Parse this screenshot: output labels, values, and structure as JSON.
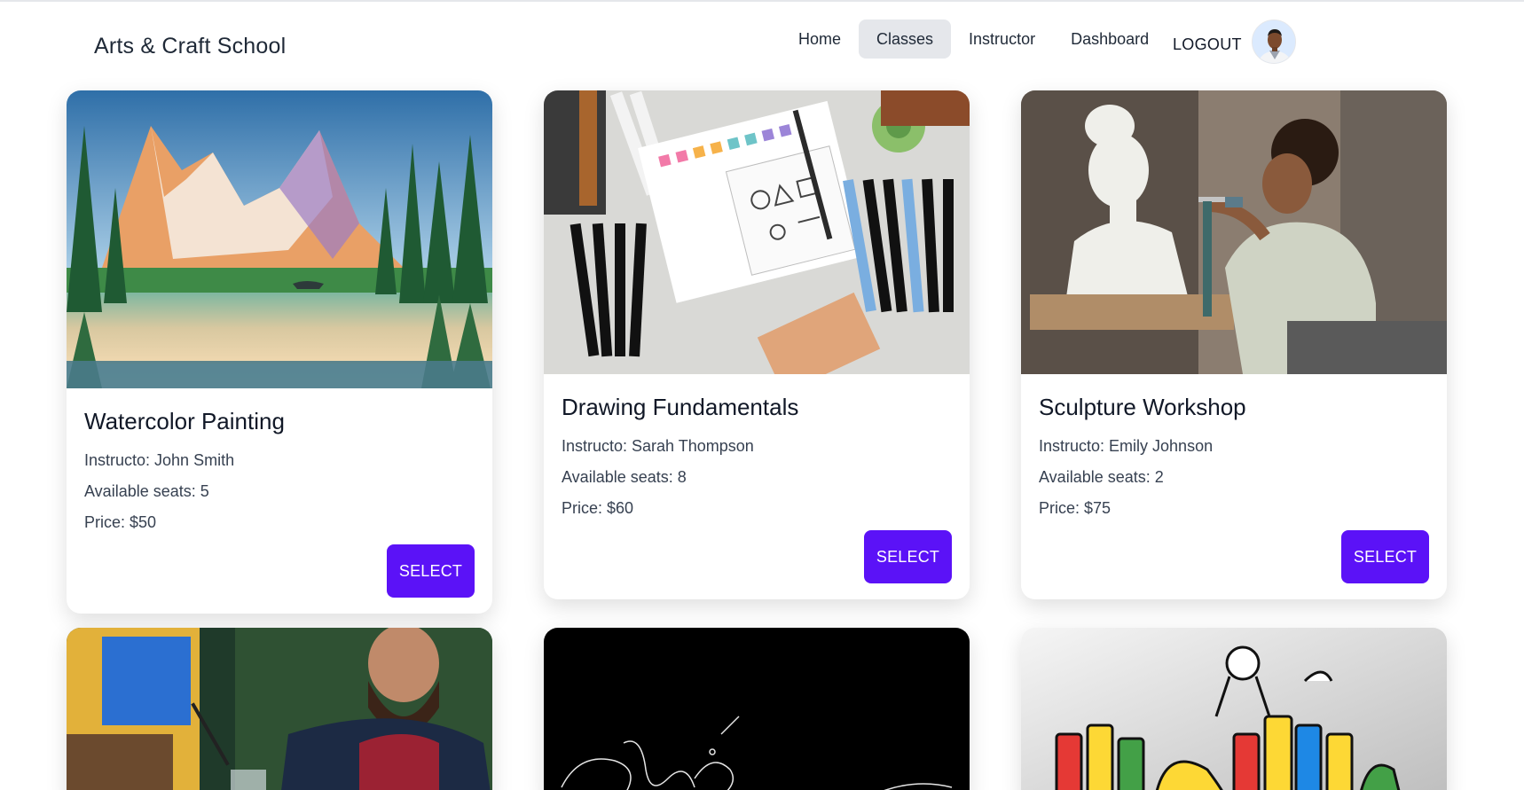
{
  "header": {
    "brand": "Arts & Craft School",
    "nav": [
      {
        "label": "Home"
      },
      {
        "label": "Classes",
        "active": true
      },
      {
        "label": "Instructor"
      },
      {
        "label": "Dashboard"
      }
    ],
    "logout_label": "LOGOUT",
    "avatar_icon": "user-avatar"
  },
  "colors": {
    "accent": "#5b12f7",
    "active_nav_bg": "#e5e7eb"
  },
  "classes": [
    {
      "title": "Watercolor Painting",
      "instructor": "Instructo: John Smith",
      "seats": "Available seats: 5",
      "price": "Price: $50",
      "button": "SELECT",
      "image": "watercolor-mountain-lake"
    },
    {
      "title": "Drawing Fundamentals",
      "instructor": "Instructo: Sarah Thompson",
      "seats": "Available seats: 8",
      "price": "Price: $60",
      "button": "SELECT",
      "image": "drawing-markers-sketchbook"
    },
    {
      "title": "Sculpture Workshop",
      "instructor": "Instructo: Emily Johnson",
      "seats": "Available seats: 2",
      "price": "Price: $75",
      "button": "SELECT",
      "image": "sculptor-with-bust"
    },
    {
      "image": "bearded-painter"
    },
    {
      "image": "black-calligraphy"
    },
    {
      "image": "graffiti-spray-cans"
    }
  ]
}
